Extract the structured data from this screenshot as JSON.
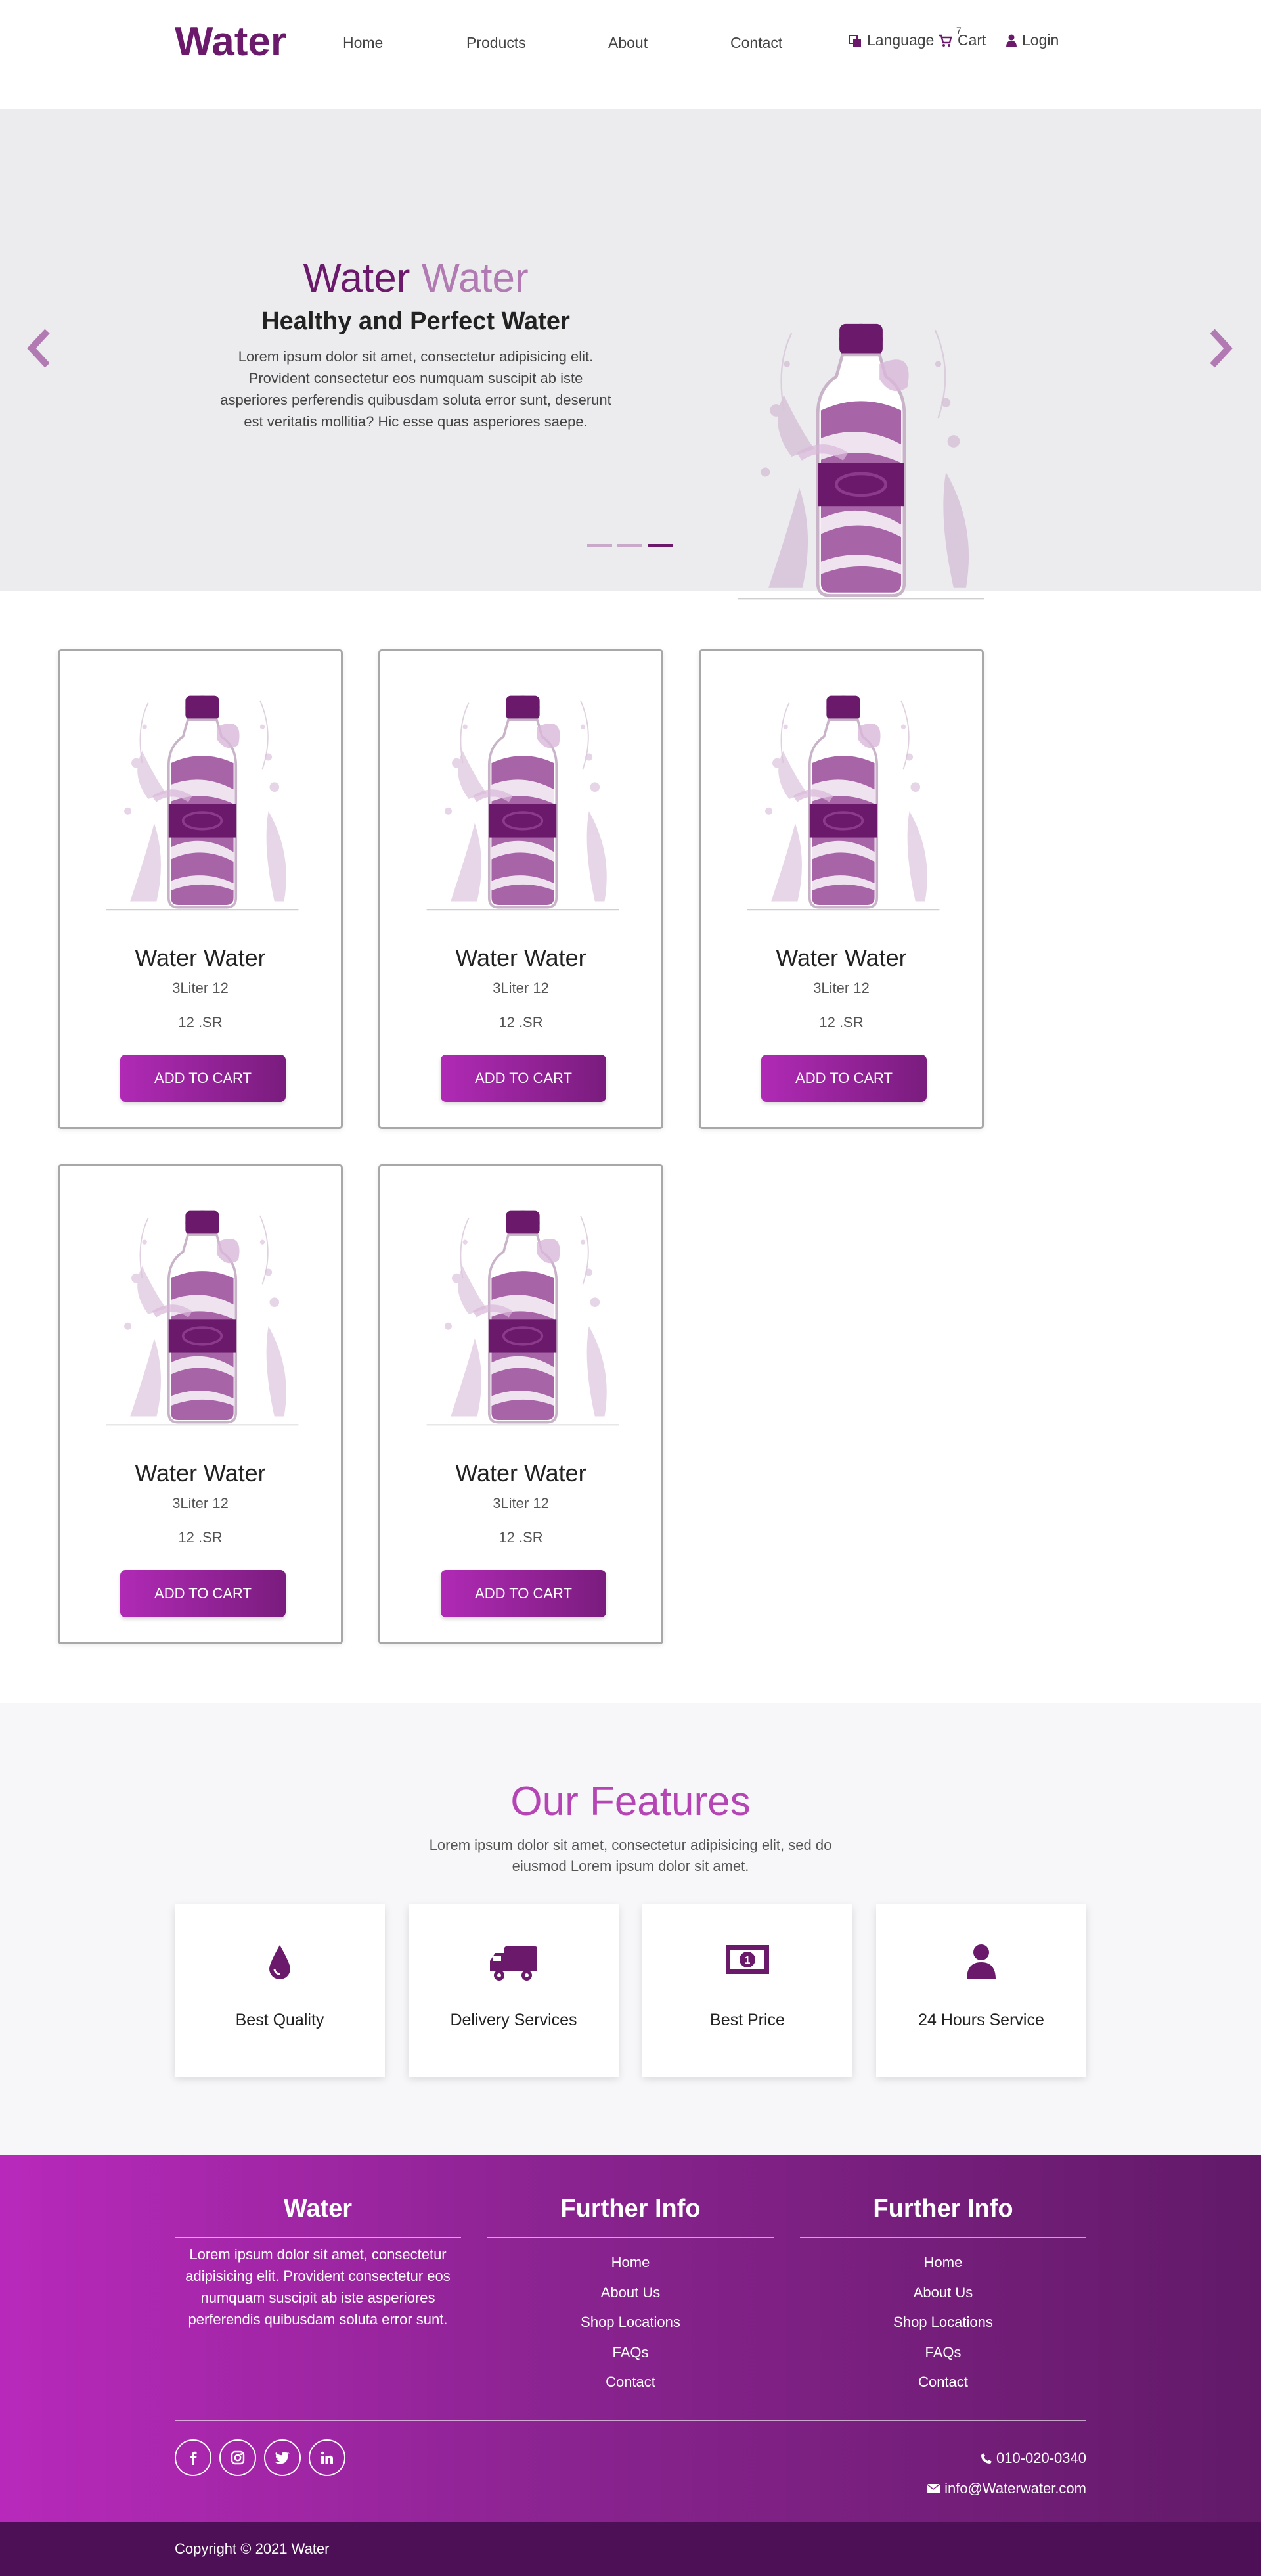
{
  "nav": {
    "brand": "Water",
    "links": [
      "Home",
      "Products",
      "About",
      "Contact"
    ],
    "language": "Language",
    "cart": "Cart",
    "cart_count": "7",
    "login": "Login"
  },
  "hero": {
    "title_main": "Water",
    "title_accent": "Water",
    "subtitle": "Healthy and Perfect Water",
    "text": "Lorem ipsum dolor sit amet, consectetur adipisicing elit. Provident consectetur eos numquam suscipit ab iste asperiores perferendis quibusdam soluta error sunt, deserunt est veritatis mollitia? Hic esse quas asperiores saepe.",
    "slides_total": 3,
    "active_slide": 3
  },
  "products": [
    {
      "title": "Water Water",
      "size": "3Liter 12",
      "price": "12 .SR",
      "button": "ADD TO CART"
    },
    {
      "title": "Water Water",
      "size": "3Liter 12",
      "price": "12 .SR",
      "button": "ADD TO CART"
    },
    {
      "title": "Water Water",
      "size": "3Liter 12",
      "price": "12 .SR",
      "button": "ADD TO CART"
    },
    {
      "title": "Water Water",
      "size": "3Liter 12",
      "price": "12 .SR",
      "button": "ADD TO CART"
    },
    {
      "title": "Water Water",
      "size": "3Liter 12",
      "price": "12 .SR",
      "button": "ADD TO CART"
    }
  ],
  "features": {
    "title": "Our Features",
    "text": "Lorem ipsum dolor sit amet, consectetur adipisicing elit, sed do eiusmod Lorem ipsum dolor sit amet.",
    "items": [
      {
        "label": "Best Quality",
        "icon": "water-drop-icon"
      },
      {
        "label": "Delivery Services",
        "icon": "truck-icon"
      },
      {
        "label": "Best Price",
        "icon": "money-icon"
      },
      {
        "label": "24 Hours Service",
        "icon": "user-icon"
      }
    ]
  },
  "footer": {
    "col1_title": "Water",
    "col1_text": "Lorem ipsum dolor sit amet, consectetur adipisicing elit. Provident consectetur eos numquam suscipit ab iste asperiores perferendis quibusdam soluta error sunt.",
    "col2_title": "Further Info",
    "col2_links": [
      "Home",
      "About Us",
      "Shop Locations",
      "FAQs",
      "Contact"
    ],
    "col3_title": "Further Info",
    "col3_links": [
      "Home",
      "About Us",
      "Shop Locations",
      "FAQs",
      "Contact"
    ],
    "social": [
      "facebook-icon",
      "instagram-icon",
      "twitter-icon",
      "linkedin-icon"
    ],
    "phone": "010-020-0340",
    "email": "info@Waterwater.com",
    "copyright": "Copyright © 2021 Water"
  },
  "colors": {
    "brand": "#6b1a6b",
    "accent": "#b02ab5",
    "light_accent": "#b27ab2"
  }
}
